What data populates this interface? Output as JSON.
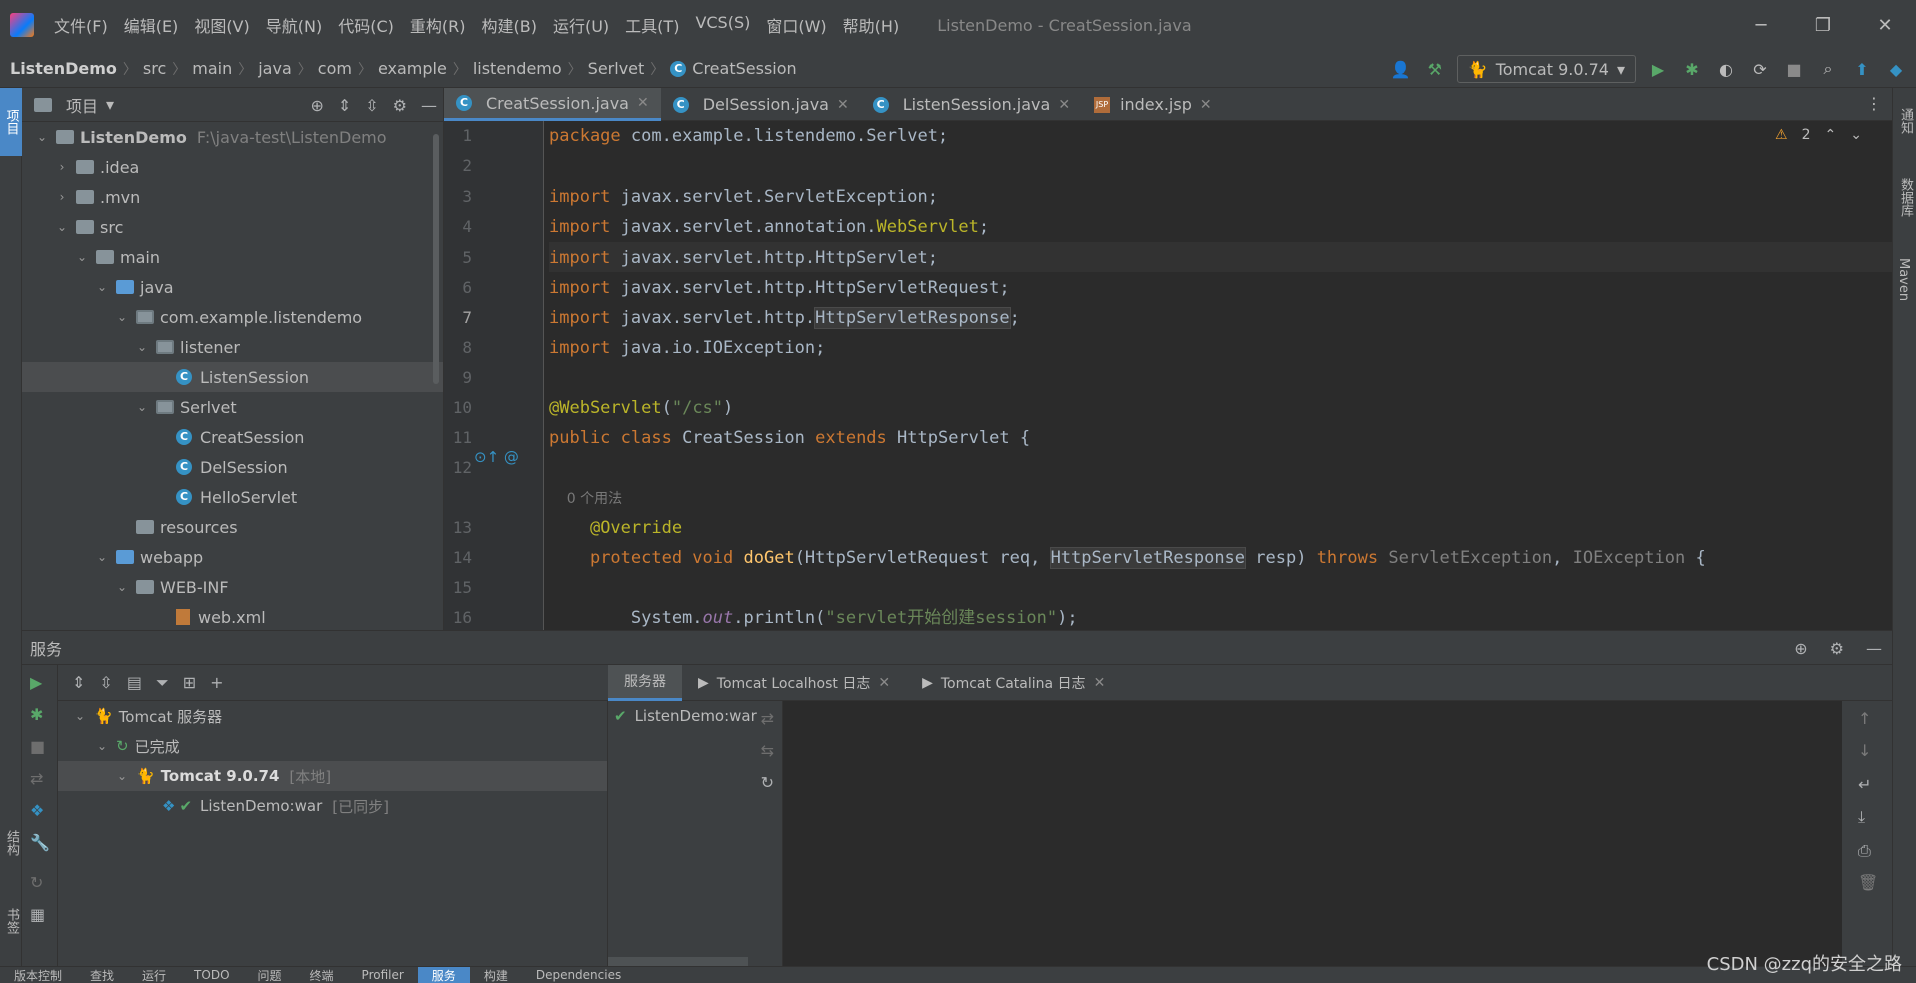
{
  "titlebar": {
    "menus": [
      "文件(F)",
      "编辑(E)",
      "视图(V)",
      "导航(N)",
      "代码(C)",
      "重构(R)",
      "构建(B)",
      "运行(U)",
      "工具(T)",
      "VCS(S)",
      "窗口(W)",
      "帮助(H)"
    ],
    "window_title": "ListenDemo - CreatSession.java",
    "minimize": "─",
    "restore": "❐",
    "close": "✕"
  },
  "breadcrumb": [
    "ListenDemo",
    "src",
    "main",
    "java",
    "com",
    "example",
    "listendemo",
    "Serlvet",
    "CreatSession"
  ],
  "run_config": {
    "label": "Tomcat 9.0.74"
  },
  "left_strip": {
    "project_tab": "项目",
    "structure": "结构",
    "bookmarks": "书签"
  },
  "right_strip": {
    "notifications": "通知",
    "database": "数据库",
    "maven": "Maven"
  },
  "project": {
    "title": "项目",
    "tree": [
      {
        "label": "ListenDemo",
        "path": "F:\\java-test\\ListenDemo",
        "kind": "module",
        "arrow": "⌄",
        "depth": 0
      },
      {
        "label": ".idea",
        "kind": "folder",
        "arrow": "›",
        "depth": 1
      },
      {
        "label": ".mvn",
        "kind": "folder",
        "arrow": "›",
        "depth": 1
      },
      {
        "label": "src",
        "kind": "folder",
        "arrow": "⌄",
        "depth": 1
      },
      {
        "label": "main",
        "kind": "folder",
        "arrow": "⌄",
        "depth": 2
      },
      {
        "label": "java",
        "kind": "folder-blue",
        "arrow": "⌄",
        "depth": 3
      },
      {
        "label": "com.example.listendemo",
        "kind": "package",
        "arrow": "⌄",
        "depth": 4
      },
      {
        "label": "listener",
        "kind": "package",
        "arrow": "⌄",
        "depth": 5
      },
      {
        "label": "ListenSession",
        "kind": "class",
        "arrow": "",
        "depth": 6,
        "selected": true
      },
      {
        "label": "Serlvet",
        "kind": "package",
        "arrow": "⌄",
        "depth": 5
      },
      {
        "label": "CreatSession",
        "kind": "class",
        "arrow": "",
        "depth": 6
      },
      {
        "label": "DelSession",
        "kind": "class",
        "arrow": "",
        "depth": 6
      },
      {
        "label": "HelloServlet",
        "kind": "class",
        "arrow": "",
        "depth": 6
      },
      {
        "label": "resources",
        "kind": "folder",
        "arrow": "",
        "depth": 4
      },
      {
        "label": "webapp",
        "kind": "folder-blue",
        "arrow": "⌄",
        "depth": 3
      },
      {
        "label": "WEB-INF",
        "kind": "folder",
        "arrow": "⌄",
        "depth": 4
      },
      {
        "label": "web.xml",
        "kind": "xml",
        "arrow": "",
        "depth": 6
      }
    ]
  },
  "editor_tabs": [
    {
      "label": "CreatSession.java",
      "icon": "C",
      "active": true
    },
    {
      "label": "DelSession.java",
      "icon": "C"
    },
    {
      "label": "ListenSession.java",
      "icon": "C"
    },
    {
      "label": "index.jsp",
      "icon": "JSP"
    }
  ],
  "editor": {
    "warning_count": "2",
    "current_line": "7",
    "line_numbers": [
      "1",
      "2",
      "3",
      "4",
      "5",
      "6",
      "7",
      "8",
      "9",
      "10",
      "11",
      "12",
      "",
      "13",
      "14",
      "15",
      "16"
    ],
    "usages_hint": "0 个用法"
  },
  "services": {
    "title": "服务",
    "tree": [
      {
        "label": "Tomcat 服务器",
        "depth": 0
      },
      {
        "label": "已完成",
        "depth": 1
      },
      {
        "label": "Tomcat 9.0.74",
        "suffix": "[本地]",
        "depth": 2
      },
      {
        "label": "ListenDemo:war",
        "suffix": "[已同步]",
        "depth": 3
      }
    ],
    "tabs": [
      "服务器",
      "Tomcat Localhost 日志",
      "Tomcat Catalina 日志"
    ],
    "deployment": "ListenDemo:war"
  },
  "statusbar": [
    "版本控制",
    "查找",
    "运行",
    "TODO",
    "问题",
    "终端",
    "Profiler",
    "服务",
    "构建",
    "Dependencies"
  ],
  "watermark": "CSDN @zzq的安全之路"
}
